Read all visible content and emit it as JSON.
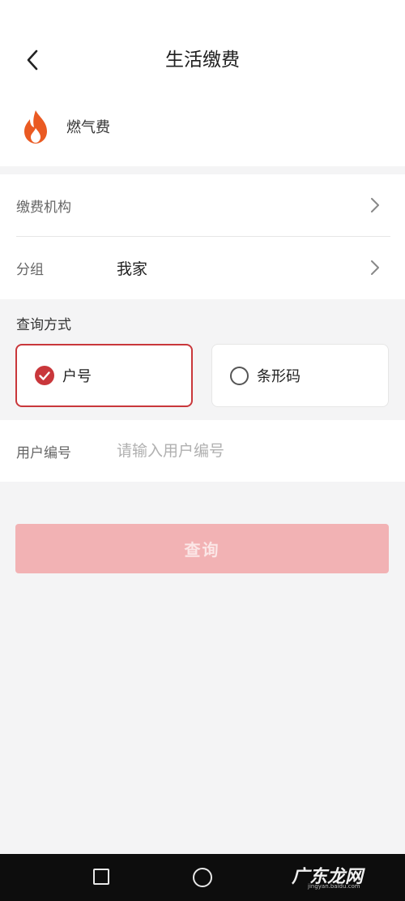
{
  "header": {
    "title": "生活缴费",
    "service_label": "燃气费"
  },
  "form": {
    "org": {
      "label": "缴费机构",
      "value": ""
    },
    "group": {
      "label": "分组",
      "value": "我家"
    },
    "query_method_title": "查询方式",
    "options": [
      {
        "label": "户号",
        "selected": true
      },
      {
        "label": "条形码",
        "selected": false
      }
    ],
    "user_no": {
      "label": "用户编号",
      "value": "",
      "placeholder": "请输入用户编号"
    },
    "query_button": "查询"
  },
  "colors": {
    "accent": "#c9373b",
    "button_disabled": "#f2b2b4",
    "flame": "#ea5a22"
  },
  "icons": {
    "back": "chevron-left-icon",
    "service": "flame-icon",
    "row_arrow": "chevron-right-icon",
    "selected": "check-circle-icon",
    "unselected": "radio-empty-icon"
  },
  "watermark": {
    "text": "广东龙网",
    "sub": "jingyan.baidu.com"
  }
}
